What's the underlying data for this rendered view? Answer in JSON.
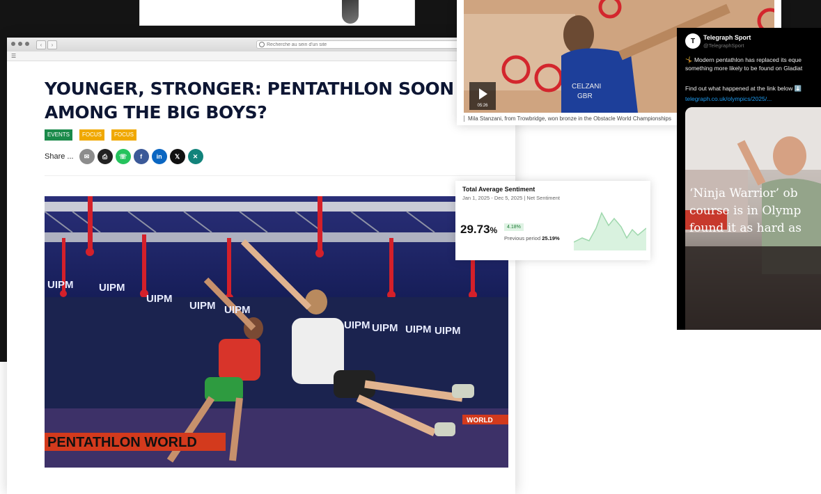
{
  "browser": {
    "url_placeholder": "Recherche au sein d'un site",
    "menu_icon": "list-icon"
  },
  "article": {
    "headline_line1": "YOUNGER, STRONGER: PENTATHLON SOON",
    "headline_line2": "AMONG THE BIG BOYS?",
    "tags": [
      {
        "label": "EVENTS",
        "color": "#1a8a4a"
      },
      {
        "label": "FOCUS",
        "color": "#f0a800"
      },
      {
        "label": "FOCUS",
        "color": "#f0a800"
      }
    ],
    "share_label": "Share ...",
    "share_buttons": [
      {
        "icon": "email-icon",
        "glyph": "✉",
        "color": "#8c8c8c"
      },
      {
        "icon": "print-icon",
        "glyph": "⎙",
        "color": "#222222"
      },
      {
        "icon": "whatsapp-icon",
        "glyph": "☏",
        "color": "#25c35d"
      },
      {
        "icon": "facebook-icon",
        "glyph": "f",
        "color": "#3b5998"
      },
      {
        "icon": "linkedin-icon",
        "glyph": "in",
        "color": "#0a66c2"
      },
      {
        "icon": "x-icon",
        "glyph": "𝕏",
        "color": "#111111"
      },
      {
        "icon": "xing-icon",
        "glyph": "✕",
        "color": "#12837b"
      }
    ],
    "hero": {
      "banner_words": [
        "UIPM",
        "UIPM",
        "UIPM",
        "UIPM",
        "UIPM",
        "UIPM",
        "UIPM",
        "UIPM",
        "UIPM"
      ],
      "floor_text": "PENTATHLON WORLD",
      "side_banner": "WORLD"
    }
  },
  "video_card": {
    "duration": "05:26",
    "caption": "Mila Stanzani, from Trowbridge, won bronze in the Obstacle World Championships",
    "shirt_text_1": "CELZANI",
    "shirt_text_2": "GBR"
  },
  "sentiment": {
    "title": "Total Average Sentiment",
    "subtitle": "Jan 1, 2025 - Dec 5, 2025 | Net Sentiment",
    "value": "29.73",
    "unit": "%",
    "badge": "4.18%",
    "previous_label": "Previous period",
    "previous_value": "25.19%"
  },
  "tweet": {
    "account_name": "Telegraph Sport",
    "handle": "@TelegraphSport",
    "line1": "🤸 Modern pentathlon has replaced its eque",
    "line2": "something more likely to be found on Gladiat",
    "line3": "Find out what happened at the link below ⬇️",
    "link": "telegraph.co.uk/olympics/2025/...",
    "card_headline_1": "‘Ninja Warrior’ ob",
    "card_headline_2": "course is in Olymp",
    "card_headline_3": "found it as hard as"
  }
}
